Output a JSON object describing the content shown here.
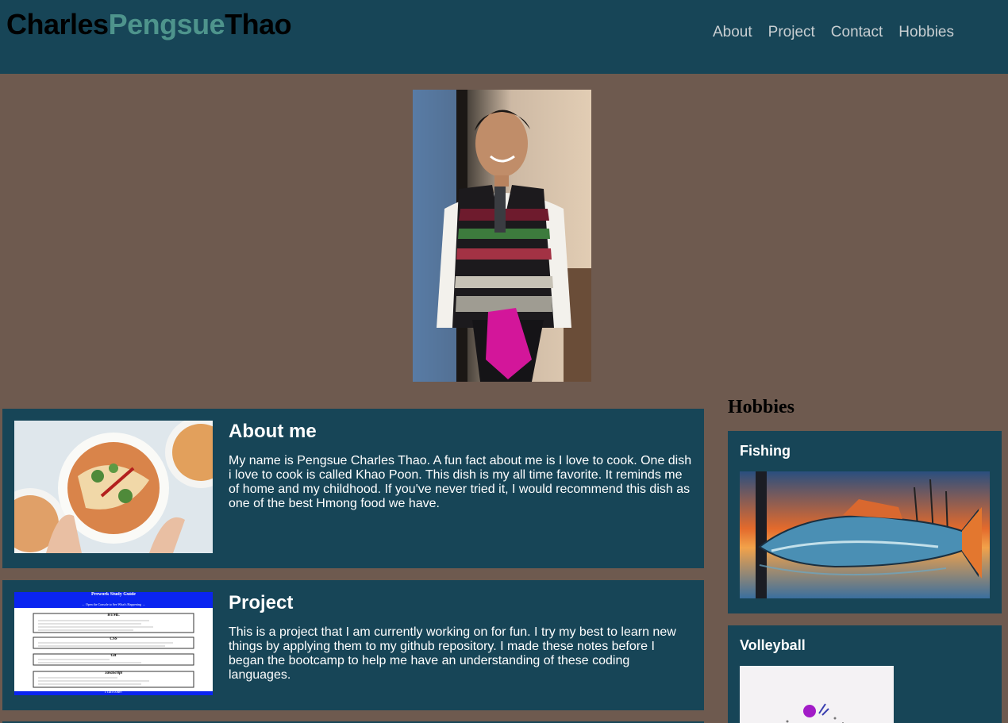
{
  "header": {
    "logo": {
      "part1": "Charles",
      "part2": "Pengsue",
      "part3": "Thao"
    },
    "nav": [
      "About",
      "Project",
      "Contact",
      "Hobbies"
    ]
  },
  "cards": {
    "about": {
      "title": "About me",
      "text": "My name is Pengsue Charles Thao. A fun fact about me is I love to cook. One dish i love to cook is called Khao Poon. This dish is my all time favorite. It reminds me of home and my childhood. If you've never tried it, I would recommend this dish as one of the best Hmong food we have."
    },
    "project": {
      "title": "Project",
      "text": "This is a project that I am currently working on for fun. I try my best to learn new things by applying them to my github repository. I made these notes before I began the bootcamp to help me have an understanding of these coding languages.",
      "thumb": {
        "title": "Prework Study Guide",
        "subtitle": "← Open the Console to See What's Happening →",
        "sections": [
          "HTML",
          "CSS",
          "Git",
          "JavaScript"
        ],
        "footer": "I can code!"
      }
    }
  },
  "hobbies": {
    "title": "Hobbies",
    "items": [
      "Fishing",
      "Volleyball"
    ]
  },
  "colors": {
    "page_bg": "#6e5a4f",
    "header_bg": "#174557",
    "accent": "#4e948c",
    "nav_text": "#c9cfd2"
  }
}
